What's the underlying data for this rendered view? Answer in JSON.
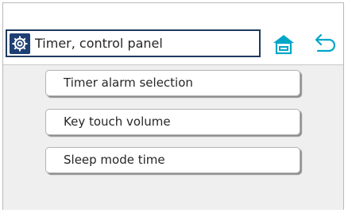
{
  "header": {
    "title": "Timer, control panel",
    "icons": {
      "title": "gear-icon",
      "home": "home-icon",
      "back": "back-arrow-icon"
    }
  },
  "menu": {
    "items": [
      {
        "label": "Timer alarm selection"
      },
      {
        "label": "Key touch volume"
      },
      {
        "label": "Sleep mode time"
      }
    ]
  },
  "colors": {
    "accent": "#00a6c8",
    "title_border": "#1f3a5f",
    "icon_badge": "#1e3f73",
    "content_background": "#efefef"
  }
}
